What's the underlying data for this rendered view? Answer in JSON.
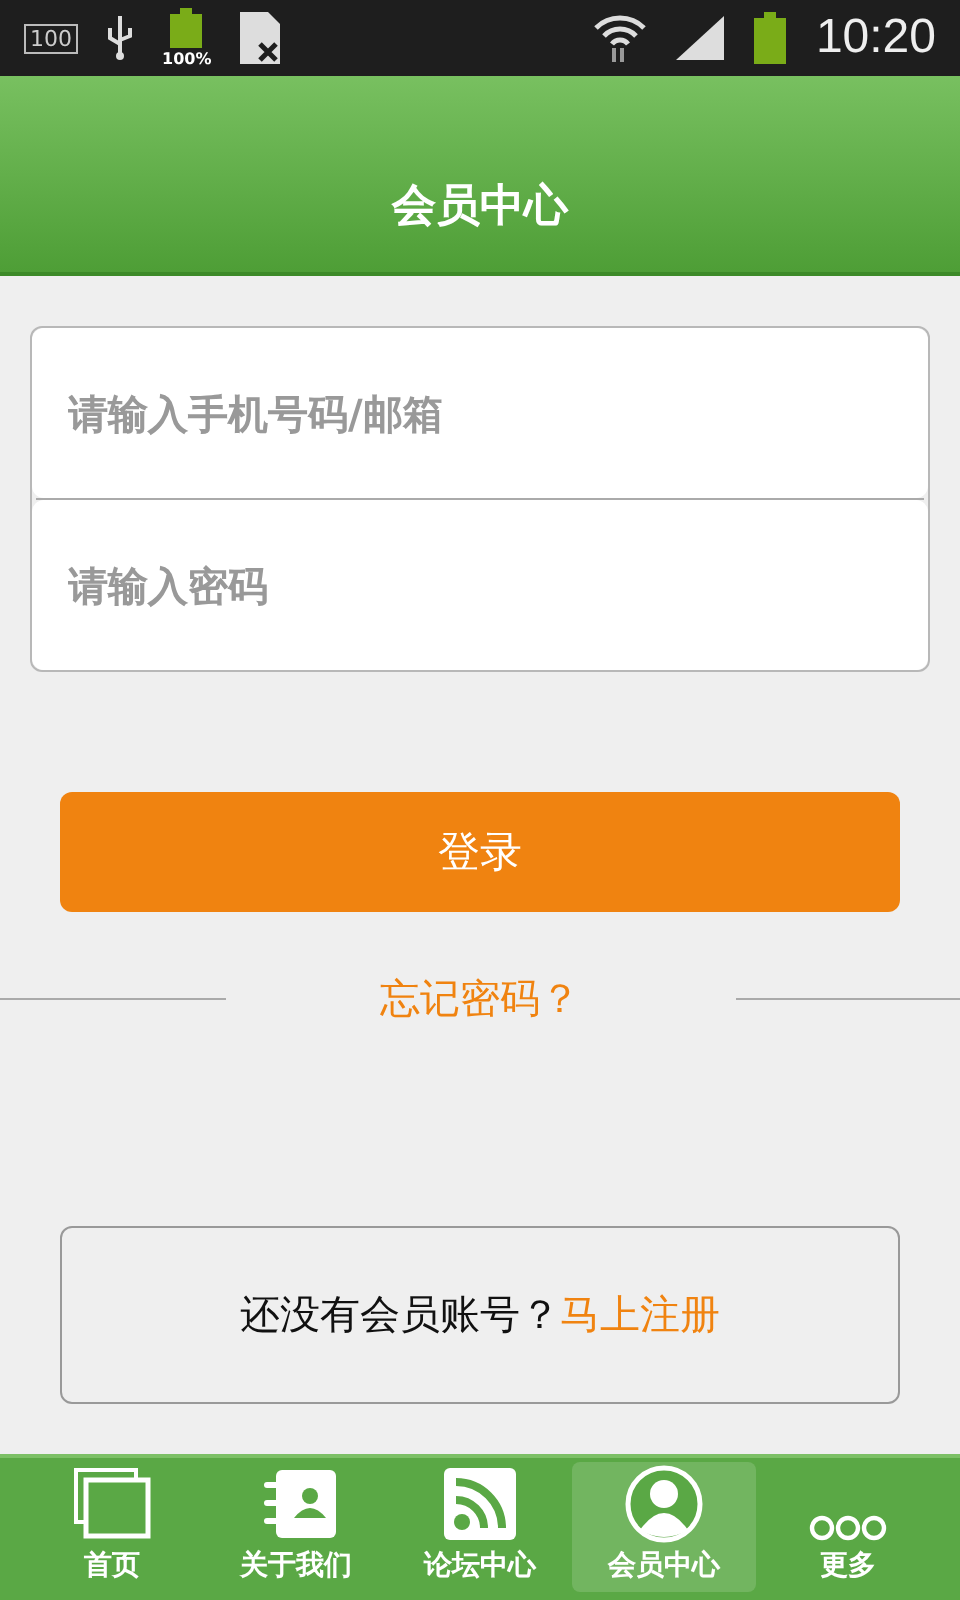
{
  "status_bar": {
    "battery_saver": "100",
    "battery_percent": "100%",
    "time": "10:20"
  },
  "header": {
    "title": "会员中心"
  },
  "form": {
    "fields": [
      {
        "placeholder": "请输入手机号码/邮箱"
      },
      {
        "placeholder": "请输入密码"
      }
    ],
    "login_button": "登录",
    "forgot_link": "忘记密码？"
  },
  "register": {
    "text": "还没有会员账号？",
    "link": "马上注册"
  },
  "nav": [
    {
      "label": "首页",
      "kind": "pages",
      "selected": false
    },
    {
      "label": "关于我们",
      "kind": "contacts",
      "selected": false
    },
    {
      "label": "论坛中心",
      "kind": "rss",
      "selected": false
    },
    {
      "label": "会员中心",
      "kind": "person",
      "selected": true
    },
    {
      "label": "更多",
      "kind": "more",
      "selected": false
    }
  ]
}
